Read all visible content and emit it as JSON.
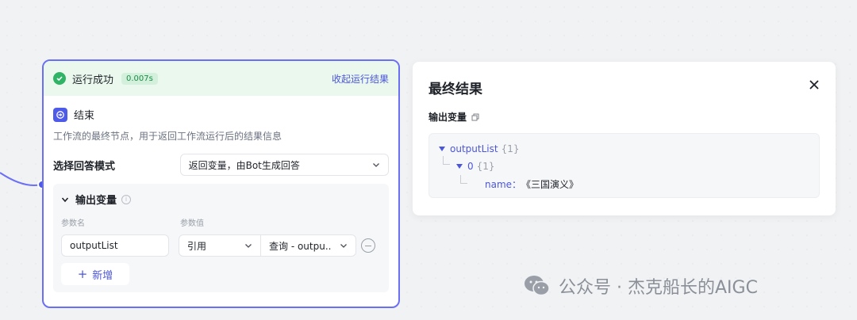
{
  "node": {
    "status": "运行成功",
    "duration": "0.007s",
    "collapse_link": "收起运行结果",
    "title": "结束",
    "description": "工作流的最终节点，用于返回工作流运行后的结果信息",
    "mode_label": "选择回答模式",
    "mode_value": "返回变量，由Bot生成回答",
    "output_section": {
      "title": "输出变量",
      "col_name": "参数名",
      "col_value": "参数值",
      "param_name": "outputList",
      "ref_type": "引用",
      "ref_value": "查询 - outpu..",
      "add_label": "新增"
    }
  },
  "result": {
    "title": "最终结果",
    "output_label": "输出变量",
    "tree": {
      "root_key": "outputList",
      "root_count": "{1}",
      "child_key": "0",
      "child_count": "{1}",
      "leaf_key": "name：",
      "leaf_value": "《三国演义》"
    }
  },
  "watermark": "公众号 · 杰克船长的AIGC",
  "colors": {
    "accent": "#4c56d9",
    "success": "#2fb364",
    "node_border": "#6b6ff5"
  }
}
